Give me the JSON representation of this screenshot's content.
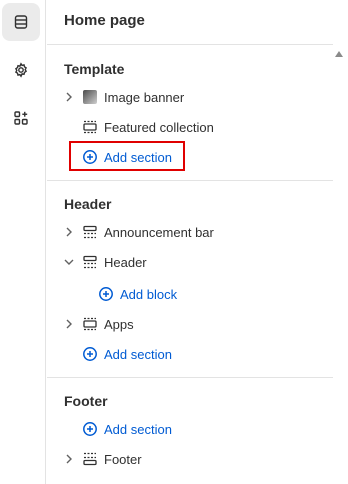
{
  "panel": {
    "title": "Home page"
  },
  "template": {
    "title": "Template",
    "items": [
      {
        "label": "Image banner",
        "icon": "image-thumbnail-icon"
      },
      {
        "label": "Featured collection",
        "icon": "section-icon"
      }
    ],
    "add_section": "Add section"
  },
  "header": {
    "title": "Header",
    "announcement_bar": "Announcement bar",
    "header_item": "Header",
    "add_block": "Add block",
    "apps": "Apps",
    "add_section": "Add section"
  },
  "footer": {
    "title": "Footer",
    "add_section": "Add section",
    "footer_item": "Footer"
  },
  "colors": {
    "accent": "#005bd3",
    "highlight": "#e00000"
  }
}
